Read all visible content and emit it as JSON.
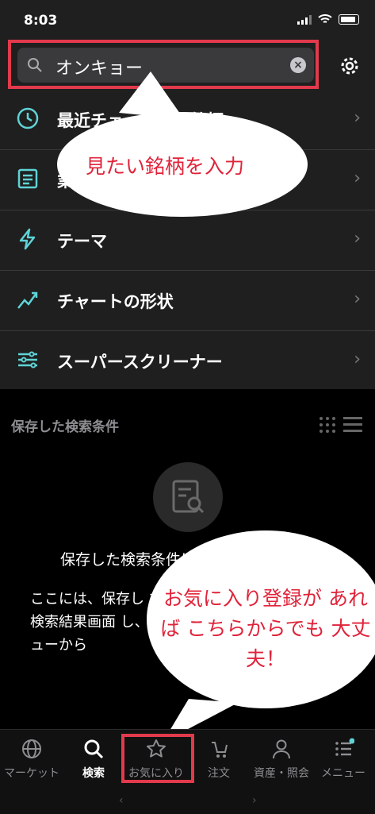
{
  "status": {
    "time": "8:03"
  },
  "search": {
    "value": "オンキョー"
  },
  "menu": [
    {
      "label": "最近チェックした銘柄",
      "icon": "clock-icon"
    },
    {
      "label": "業種",
      "icon": "document-icon"
    },
    {
      "label": "テーマ",
      "icon": "lightning-icon"
    },
    {
      "label": "チャートの形状",
      "icon": "trend-icon"
    },
    {
      "label": "スーパースクリーナー",
      "icon": "sliders-icon"
    }
  ],
  "saved": {
    "title": "保存した検索条件",
    "empty_title": "保存した検索条件は",
    "empty_desc": "ここには、保存し す。検索結果画面 し、メニューから"
  },
  "annotations": {
    "bubble1": "見たい銘柄を入力",
    "bubble2": "お気に入り登録が あれば こちらからでも 大丈夫！"
  },
  "tabs": [
    {
      "label": "マーケット",
      "icon": "globe-icon"
    },
    {
      "label": "検索",
      "icon": "search-icon"
    },
    {
      "label": "お気に入り",
      "icon": "star-icon"
    },
    {
      "label": "注文",
      "icon": "cart-icon"
    },
    {
      "label": "資産・照会",
      "icon": "person-icon"
    },
    {
      "label": "メニュー",
      "icon": "menu-icon"
    }
  ],
  "colors": {
    "accent": "#5fd3d6",
    "annotation": "#e0233a"
  }
}
